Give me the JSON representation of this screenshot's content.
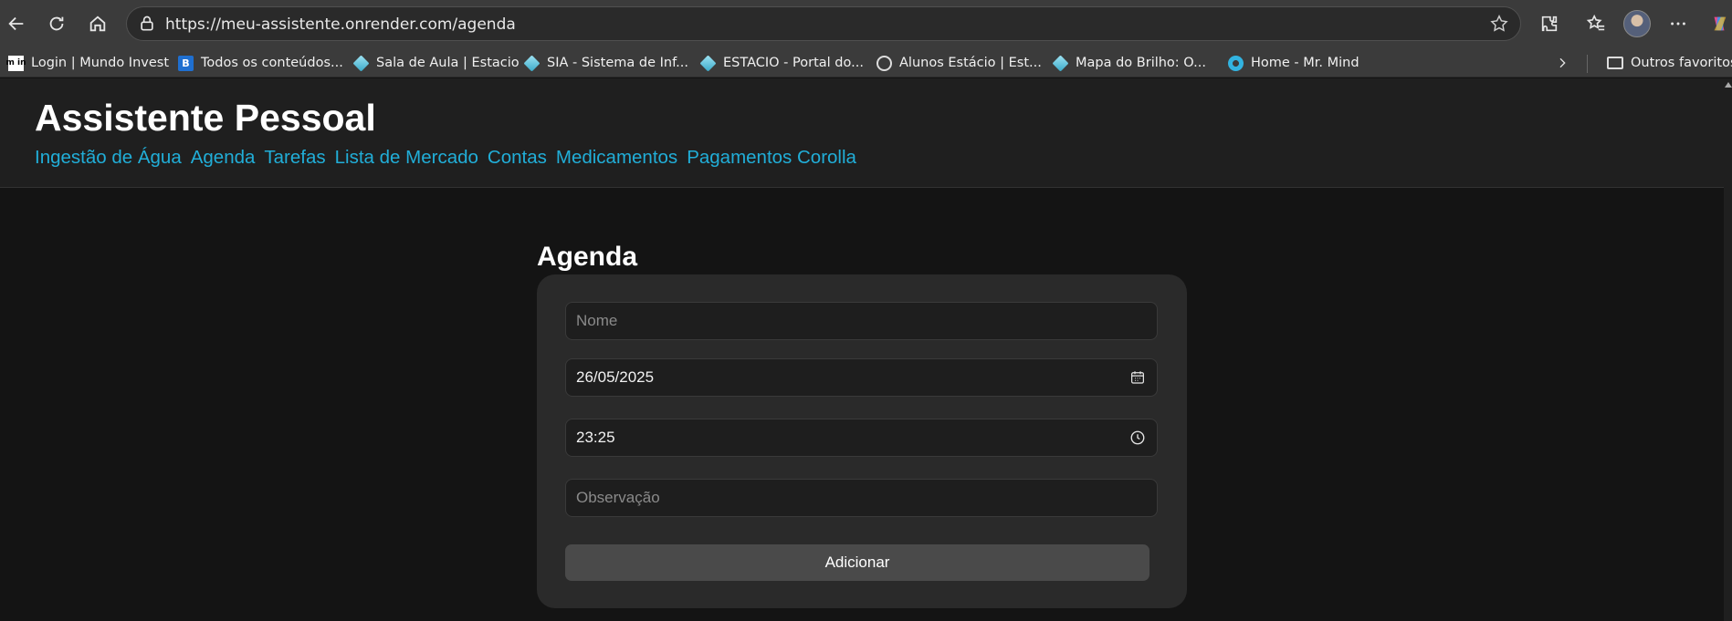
{
  "browser": {
    "url": "https://meu-assistente.onrender.com/agenda",
    "bookmarks": [
      {
        "label": "Login | Mundo Invest",
        "icon": "mundo-invest-icon"
      },
      {
        "label": "Todos os conteúdos...",
        "icon": "blue-b-icon"
      },
      {
        "label": "Sala de Aula | Estacio",
        "icon": "diamond-icon"
      },
      {
        "label": "SIA - Sistema de Inf...",
        "icon": "diamond-icon"
      },
      {
        "label": "ESTACIO - Portal do...",
        "icon": "diamond-icon"
      },
      {
        "label": "Alunos Estácio | Est...",
        "icon": "globe-icon"
      },
      {
        "label": "Mapa do Brilho: O...",
        "icon": "diamond-icon"
      },
      {
        "label": "Home - Mr. Mind",
        "icon": "gear-icon"
      }
    ],
    "other_favorites": "Outros favoritos",
    "mi_logo": "m in"
  },
  "site": {
    "title": "Assistente Pessoal",
    "nav": [
      "Ingestão de Água",
      "Agenda",
      "Tarefas",
      "Lista de Mercado",
      "Contas",
      "Medicamentos",
      "Pagamentos Corolla"
    ],
    "link_color": "#21aed8"
  },
  "agenda": {
    "heading": "Agenda",
    "nome_placeholder": "Nome",
    "date_value": "26/05/2025",
    "time_value": "23:25",
    "obs_placeholder": "Observação",
    "add_label": "Adicionar"
  }
}
